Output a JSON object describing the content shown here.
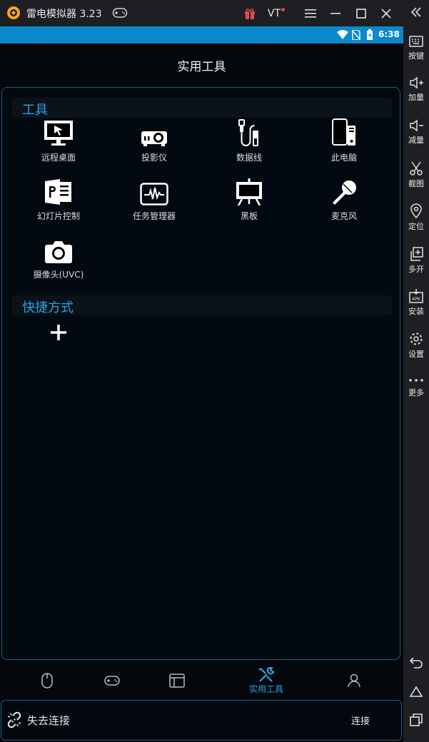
{
  "window": {
    "title": "雷电模拟器 3.23",
    "vt_label": "VT"
  },
  "statusbar": {
    "time": "6:38"
  },
  "page": {
    "title": "实用工具"
  },
  "tools_section": {
    "title": "工具",
    "items": [
      {
        "label": "远程桌面",
        "icon": "monitor-icon"
      },
      {
        "label": "投影仪",
        "icon": "projector-icon"
      },
      {
        "label": "数据线",
        "icon": "usb-cable-icon"
      },
      {
        "label": "此电脑",
        "icon": "devices-icon"
      },
      {
        "label": "幻灯片控制",
        "icon": "powerpoint-icon"
      },
      {
        "label": "任务管理器",
        "icon": "activity-monitor-icon"
      },
      {
        "label": "黑板",
        "icon": "blackboard-icon"
      },
      {
        "label": "麦克风",
        "icon": "microphone-icon"
      },
      {
        "label": "摄像头(UVC)",
        "icon": "camera-icon"
      }
    ]
  },
  "shortcuts_section": {
    "title": "快捷方式"
  },
  "bottom_nav": {
    "active_label": "实用工具"
  },
  "connection": {
    "status": "失去连接",
    "connect_label": "连接"
  },
  "sidebar": {
    "items": [
      {
        "label": "按键",
        "icon": "keyboard-icon"
      },
      {
        "label": "加量",
        "icon": "volume-up-icon"
      },
      {
        "label": "减量",
        "icon": "volume-down-icon"
      },
      {
        "label": "截图",
        "icon": "scissors-icon"
      },
      {
        "label": "定位",
        "icon": "location-pin-icon"
      },
      {
        "label": "多开",
        "icon": "multi-window-icon"
      },
      {
        "label": "安装",
        "icon": "apk-install-icon"
      },
      {
        "label": "设置",
        "icon": "gear-icon"
      },
      {
        "label": "更多",
        "icon": "more-dots-icon"
      }
    ]
  },
  "colors": {
    "accent": "#27a3e6",
    "statusbar": "#0a8ac8",
    "chrome": "#1e1f22"
  }
}
